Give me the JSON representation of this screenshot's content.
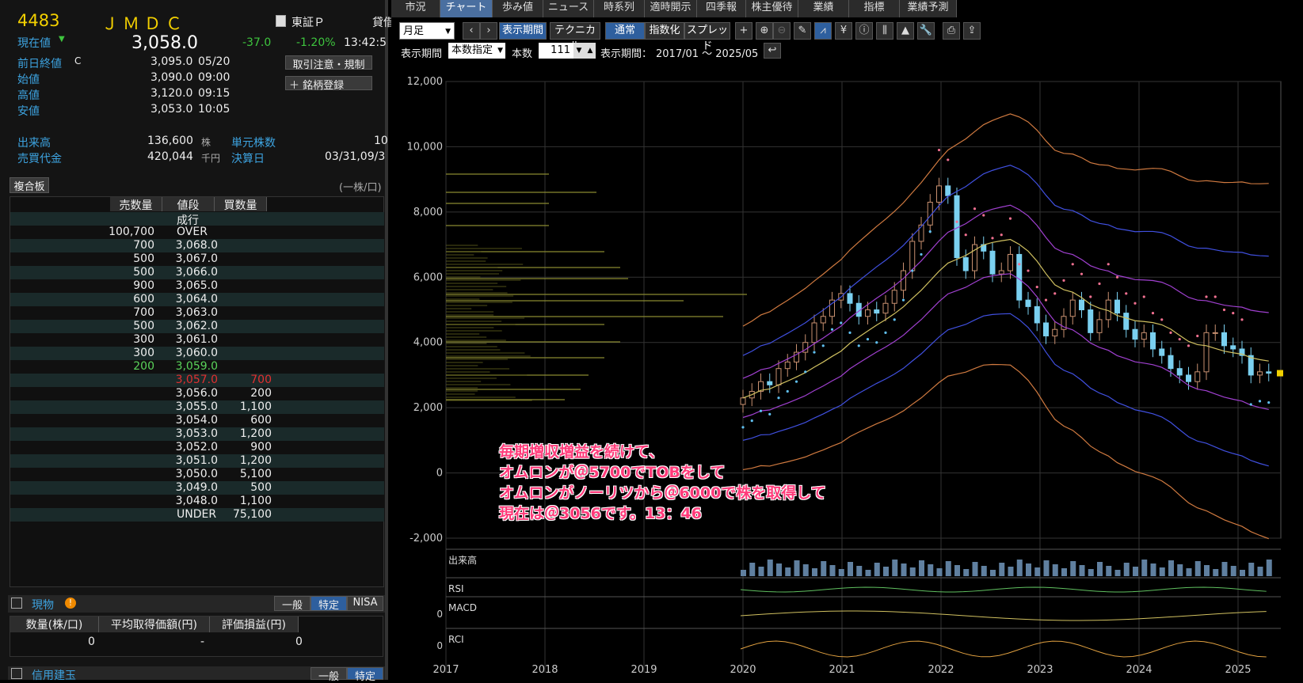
{
  "quote": {
    "code": "4483",
    "name": "ＪＭＤＣ",
    "exchange": "東証Ｐ",
    "lending": "貸借",
    "current_label": "現在値",
    "price": "3,058.0",
    "change": "-37.0",
    "change_pct": "-1.20%",
    "time": "13:42:5",
    "prev_label": "前日終値",
    "prev_flag": "C",
    "prev_val": "3,095.0",
    "prev_date": "05/20",
    "open_label": "始値",
    "open_val": "3,090.0",
    "open_time": "09:00",
    "high_label": "高値",
    "high_val": "3,120.0",
    "high_time": "09:15",
    "low_label": "安値",
    "low_val": "3,053.0",
    "low_time": "10:05",
    "volume_label": "出来高",
    "volume_val": "136,600",
    "volume_unit": "株",
    "unit_label": "単元株数",
    "unit_val": "10",
    "turnover_label": "売買代金",
    "turnover_val": "420,044",
    "turnover_unit": "千円",
    "settle_label": "決算日",
    "settle_val": "03/31,09/3",
    "btn_caution": "取引注意・規制",
    "btn_register": "銘柄登録",
    "btn_plus": "＋"
  },
  "board": {
    "title": "複合板",
    "unit": "(一株/口)",
    "headers": [
      "売数量",
      "値段",
      "買数量"
    ],
    "rows": [
      [
        "",
        "成行",
        ""
      ],
      [
        "100,700",
        "OVER",
        ""
      ],
      [
        "700",
        "3,068.0",
        ""
      ],
      [
        "500",
        "3,067.0",
        ""
      ],
      [
        "500",
        "3,066.0",
        ""
      ],
      [
        "900",
        "3,065.0",
        ""
      ],
      [
        "600",
        "3,064.0",
        ""
      ],
      [
        "700",
        "3,063.0",
        ""
      ],
      [
        "500",
        "3,062.0",
        ""
      ],
      [
        "300",
        "3,061.0",
        ""
      ],
      [
        "300",
        "3,060.0",
        ""
      ],
      [
        "200",
        "3,059.0",
        ""
      ],
      [
        "",
        "3,057.0",
        "700"
      ],
      [
        "",
        "3,056.0",
        "200"
      ],
      [
        "",
        "3,055.0",
        "1,100"
      ],
      [
        "",
        "3,054.0",
        "600"
      ],
      [
        "",
        "3,053.0",
        "1,200"
      ],
      [
        "",
        "3,052.0",
        "900"
      ],
      [
        "",
        "3,051.0",
        "1,200"
      ],
      [
        "",
        "3,050.0",
        "5,100"
      ],
      [
        "",
        "3,049.0",
        "500"
      ],
      [
        "",
        "3,048.0",
        "1,100"
      ],
      [
        "",
        "UNDER",
        "75,100"
      ]
    ]
  },
  "position": {
    "title": "現物",
    "tabs": [
      "一般",
      "特定",
      "NISA"
    ],
    "headers": [
      "数量(株/口)",
      "平均取得価額(円)",
      "評価損益(円)"
    ],
    "values": [
      "0",
      "-",
      "0"
    ],
    "credit_title": "信用建玉",
    "credit_tabs": [
      "一般",
      "特定"
    ]
  },
  "tabs": [
    "市況",
    "チャート",
    "歩み値",
    "ニュース",
    "時系列",
    "適時開示",
    "四季報",
    "株主優待",
    "業績",
    "指標",
    "業績予測"
  ],
  "toolbar": {
    "period": "月足",
    "btn_range": "表示期間",
    "btn_tech": "テクニカル",
    "btn_normal": "通常",
    "btn_index": "指数化",
    "btn_spread": "スプレッド"
  },
  "toolbar2": {
    "range_label": "表示期間",
    "mode": "本数指定",
    "count_label": "本数",
    "count": "111",
    "period_label": "表示期間：",
    "period": "2017/01 ～ 2025/05"
  },
  "annotation": [
    "毎期増収増益を続けて、",
    "オムロンが＠5700でTOBをして",
    "オムロンがノーリツから＠6000で株を取得して",
    "現在は＠3056です。13：46"
  ],
  "panels": [
    "出来高",
    "RSI",
    "MACD",
    "RCI"
  ],
  "panel_zero": "0",
  "chart_data": {
    "type": "candlestick",
    "ylim": [
      -2000,
      12000
    ],
    "yticks": [
      "12,000",
      "10,000",
      "8,000",
      "6,000",
      "4,000",
      "2,000",
      "0",
      "-2,000"
    ],
    "xticks": [
      "2017",
      "2018",
      "2019",
      "2020",
      "2021",
      "2022",
      "2023",
      "2024",
      "2025"
    ]
  }
}
